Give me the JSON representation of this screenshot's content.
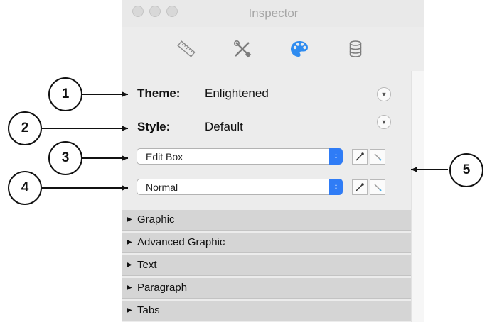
{
  "window": {
    "title": "Inspector"
  },
  "toolbar": {
    "tabs": [
      {
        "icon": "ruler-icon"
      },
      {
        "icon": "tools-icon"
      },
      {
        "icon": "palette-icon",
        "selected": true
      },
      {
        "icon": "database-icon"
      }
    ]
  },
  "theme": {
    "label": "Theme:",
    "value": "Enlightened"
  },
  "style": {
    "label": "Style:",
    "value": "Default"
  },
  "popups": [
    {
      "value": "Edit Box"
    },
    {
      "value": "Normal"
    }
  ],
  "sections": [
    "Graphic",
    "Advanced Graphic",
    "Text",
    "Paragraph",
    "Tabs"
  ],
  "callouts": [
    "1",
    "2",
    "3",
    "4",
    "5"
  ],
  "colors": {
    "accent": "#2f7cf6",
    "section_bg": "#d5d5d5",
    "panel_bg": "#ececec"
  }
}
